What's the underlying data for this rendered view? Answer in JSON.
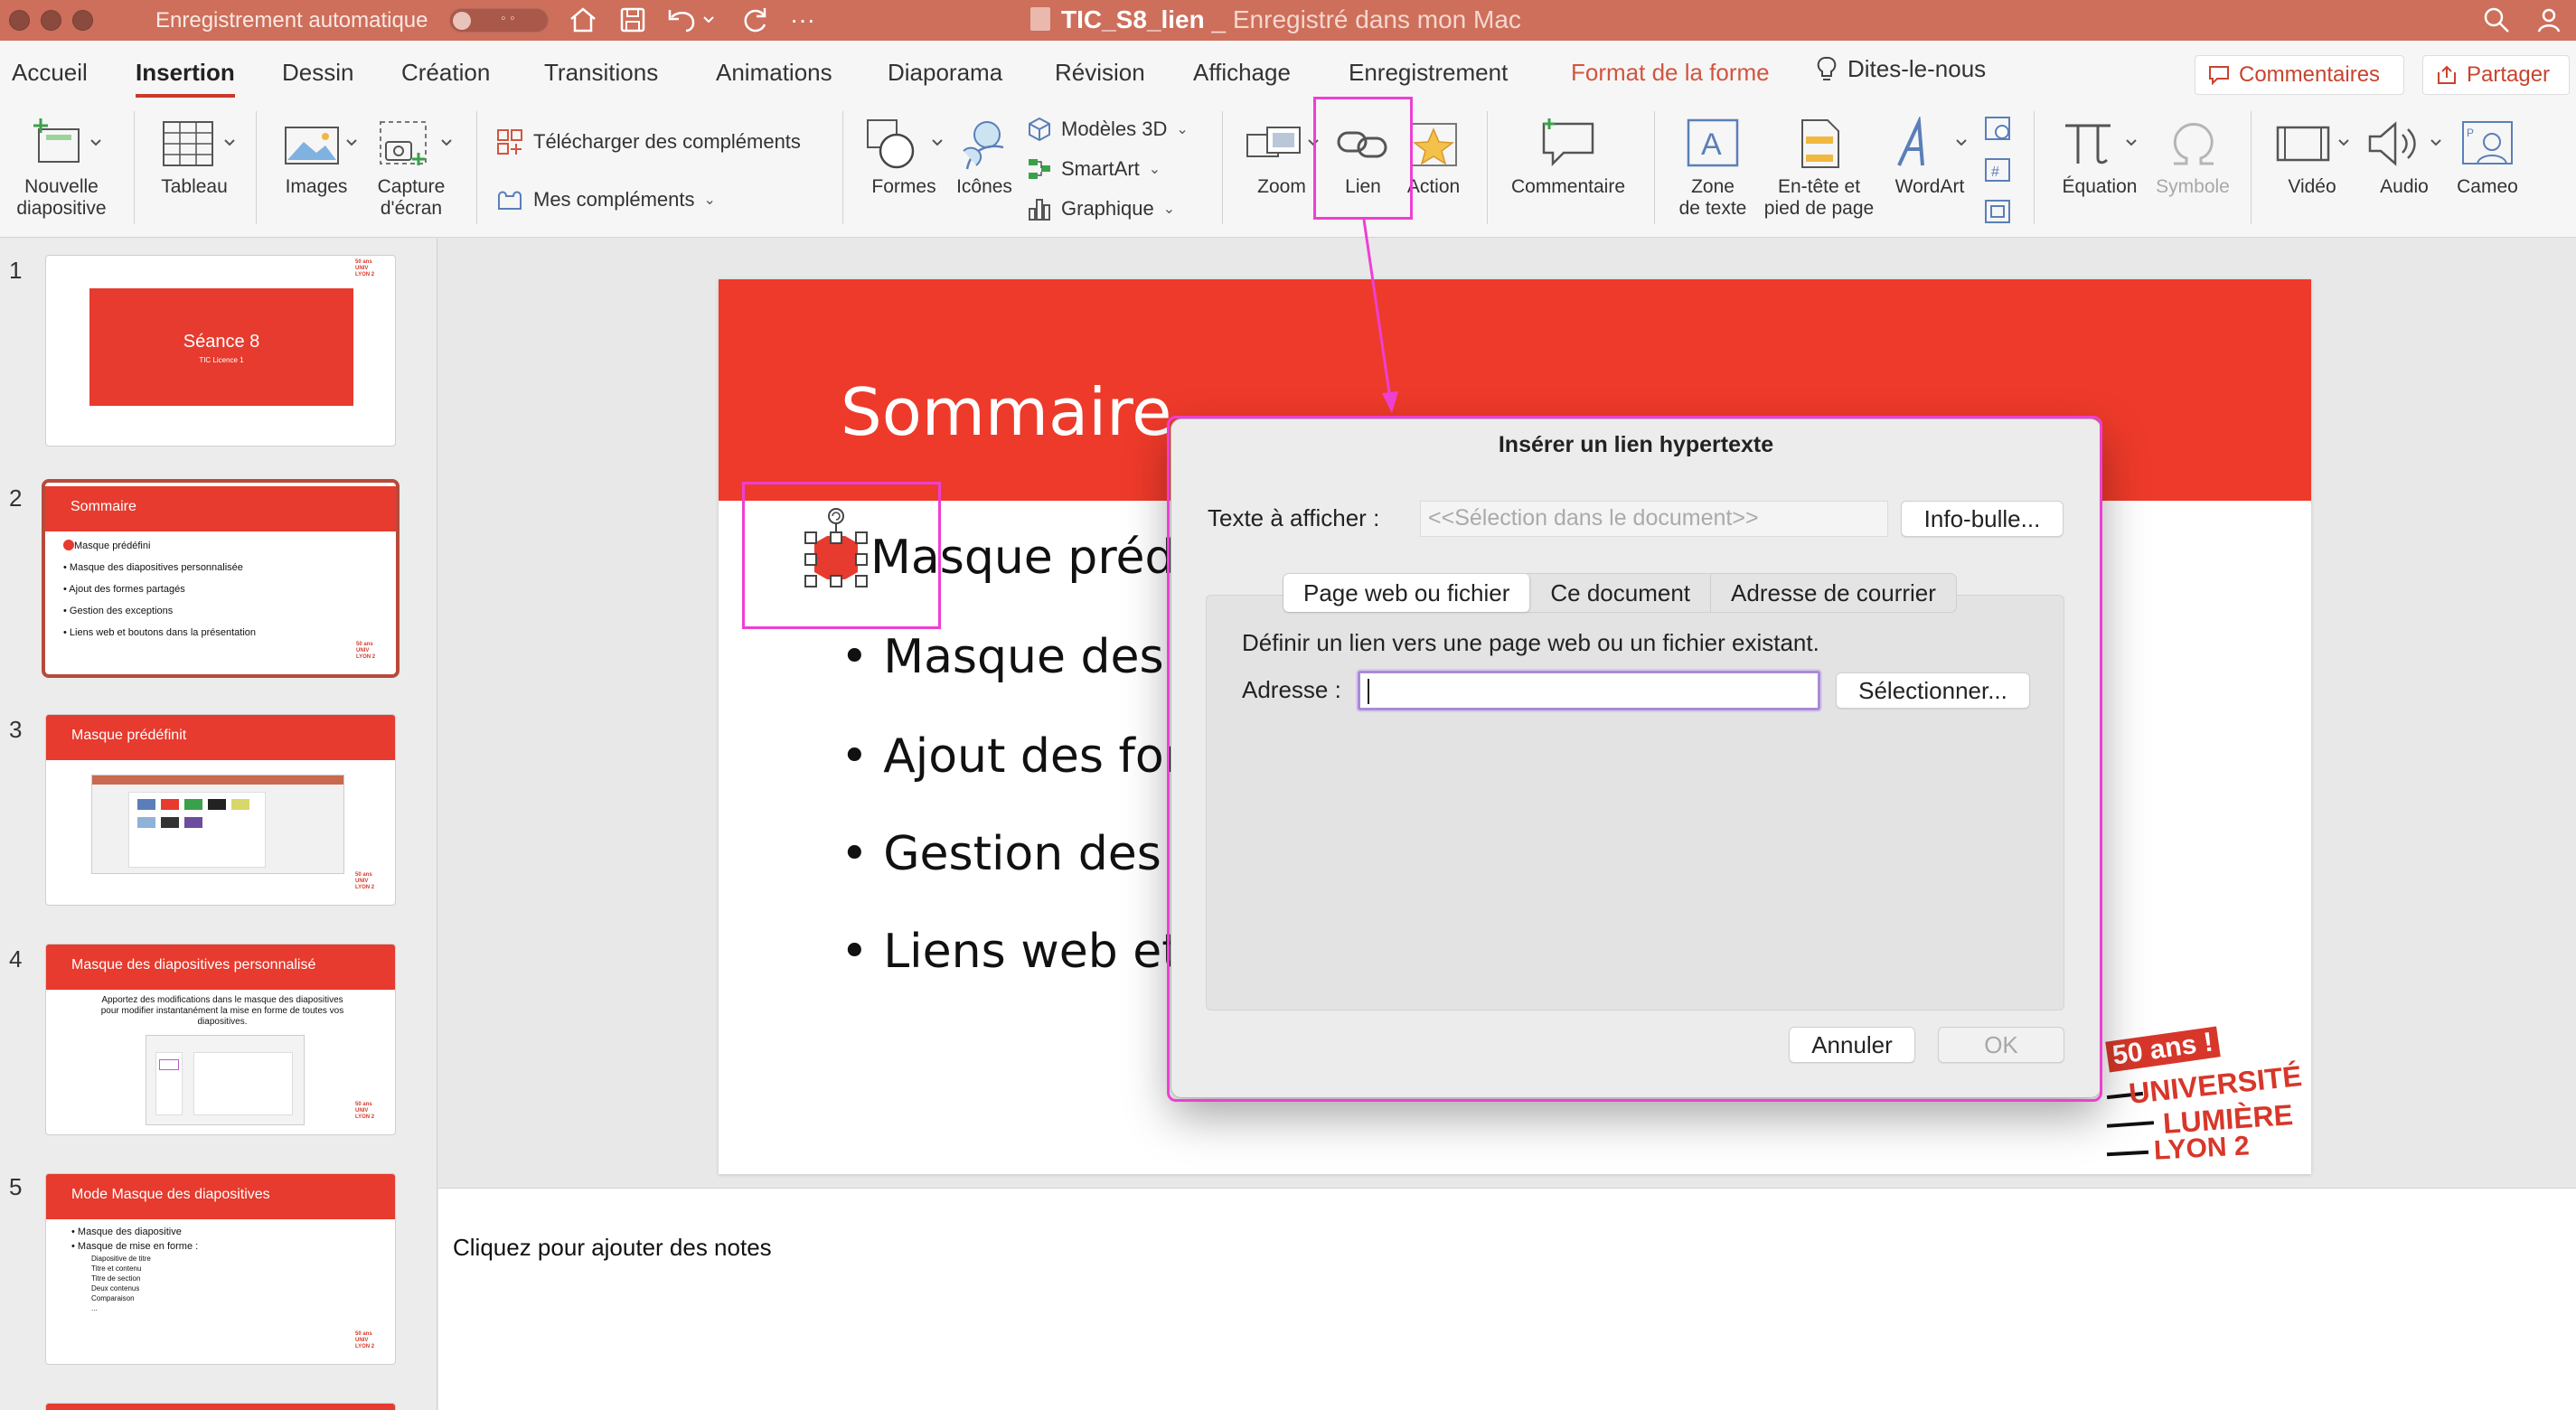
{
  "titlebar": {
    "autosave_label": "Enregistrement automatique",
    "autosave_state": "off",
    "doc_name": "TIC_S8_lien",
    "doc_status": "_ Enregistré dans mon Mac"
  },
  "tabs": [
    {
      "label": "Accueil"
    },
    {
      "label": "Insertion"
    },
    {
      "label": "Dessin"
    },
    {
      "label": "Création"
    },
    {
      "label": "Transitions"
    },
    {
      "label": "Animations"
    },
    {
      "label": "Diaporama"
    },
    {
      "label": "Révision"
    },
    {
      "label": "Affichage"
    },
    {
      "label": "Enregistrement"
    },
    {
      "label": "Format de la forme"
    },
    {
      "label": "Dites-le-nous"
    }
  ],
  "tabs_right": {
    "comments": "Commentaires",
    "share": "Partager"
  },
  "ribbon": {
    "new_slide_1": "Nouvelle",
    "new_slide_2": "diapositive",
    "table": "Tableau",
    "images": "Images",
    "screenshot_1": "Capture",
    "screenshot_2": "d'écran",
    "get_addins": "Télécharger des compléments",
    "my_addins": "Mes compléments",
    "shapes": "Formes",
    "icons": "Icônes",
    "models3d": "Modèles 3D",
    "smartart": "SmartArt",
    "chart": "Graphique",
    "zoom": "Zoom",
    "link": "Lien",
    "action": "Action",
    "comment": "Commentaire",
    "textbox_1": "Zone",
    "textbox_2": "de texte",
    "header_1": "En-tête et",
    "header_2": "pied de page",
    "wordart": "WordArt",
    "equation": "Équation",
    "symbol": "Symbole",
    "video": "Vidéo",
    "audio": "Audio",
    "cameo": "Cameo"
  },
  "thumbnails": [
    {
      "num": "1",
      "title": "Séance 8",
      "subtitle": "TIC Licence 1"
    },
    {
      "num": "2",
      "title": "Sommaire",
      "bullets": [
        "Masque prédéfini",
        "• Masque des diapositives personnalisée",
        "• Ajout des formes partagés",
        "• Gestion des exceptions",
        "• Liens web et boutons dans la présentation"
      ]
    },
    {
      "num": "3",
      "title": "Masque prédéfinit"
    },
    {
      "num": "4",
      "title": "Masque des diapositives personnalisé",
      "body": "Apportez des modifications dans le masque des diapositives pour modifier instantanément la mise en forme de toutes vos diapositives."
    },
    {
      "num": "5",
      "title": "Mode Masque des diapositives",
      "bullets": [
        "• Masque des diapositive",
        "• Masque de mise en forme :",
        "Diapositive de titre",
        "Titre et contenu",
        "Titre de section",
        "Deux contenus",
        "Comparaison",
        "..."
      ]
    }
  ],
  "slide": {
    "title": "Sommaire",
    "bullets": [
      "Masque préde",
      "• Masque des d",
      "• Ajout des form",
      "• Gestion des ex",
      "• Liens web et b"
    ],
    "logo": {
      "l1": "50 ans !",
      "l2": "UNIVERSITÉ",
      "l3": "LUMIÈRE",
      "l4": "LYON 2"
    }
  },
  "notes_placeholder": "Cliquez pour ajouter des notes",
  "dialog": {
    "title": "Insérer un lien hypertexte",
    "display_text_label": "Texte à afficher :",
    "display_text_placeholder": "<<Sélection dans le document>>",
    "tooltip_button": "Info-bulle...",
    "tabs": [
      "Page web ou fichier",
      "Ce document",
      "Adresse de courrier"
    ],
    "description": "Définir un lien vers une page web ou un fichier existant.",
    "address_label": "Adresse :",
    "address_value": "",
    "select_button": "Sélectionner...",
    "cancel_button": "Annuler",
    "ok_button": "OK"
  },
  "colors": {
    "accent": "#c93a2c",
    "slide_band": "#ee3a2a",
    "highlight": "#ee3fd3",
    "titlebar": "#cd6f5b"
  }
}
